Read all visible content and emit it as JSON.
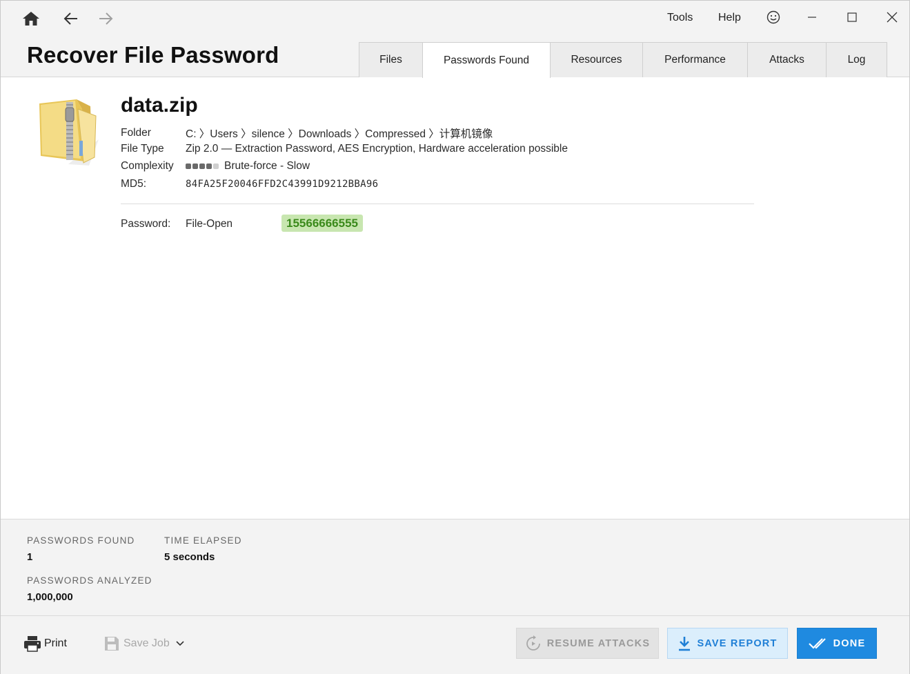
{
  "header": {
    "title": "Recover File Password",
    "menu": {
      "tools": "Tools",
      "help": "Help"
    },
    "tabs": [
      {
        "label": "Files"
      },
      {
        "label": "Passwords Found"
      },
      {
        "label": "Resources"
      },
      {
        "label": "Performance"
      },
      {
        "label": "Attacks"
      },
      {
        "label": "Log"
      }
    ],
    "active_tab": "Passwords Found"
  },
  "file": {
    "name": "data.zip",
    "folder_label": "Folder",
    "folder_value": "C: 〉Users 〉silence 〉Downloads 〉Compressed 〉计算机镜像",
    "type_label": "File Type",
    "type_value": "Zip 2.0 — Extraction Password, AES Encryption, Hardware acceleration possible",
    "complexity_label": "Complexity",
    "complexity_level": 4,
    "complexity_max": 5,
    "complexity_value": "Brute-force - Slow",
    "md5_label": "MD5:",
    "md5_value": "84FA25F20046FFD2C43991D9212BBA96"
  },
  "password": {
    "label": "Password:",
    "kind": "File-Open",
    "value": "15566666555"
  },
  "stats": {
    "found_label": "PASSWORDS FOUND",
    "found_value": "1",
    "elapsed_label": "TIME ELAPSED",
    "elapsed_value": "5 seconds",
    "analyzed_label": "PASSWORDS ANALYZED",
    "analyzed_value": "1,000,000"
  },
  "footer": {
    "print_label": "Print",
    "save_job_label": "Save Job",
    "resume_label": "RESUME ATTACKS",
    "save_report_label": "SAVE REPORT",
    "done_label": "DONE"
  },
  "colors": {
    "accent": "#1f8ae0",
    "password_badge_bg": "#c8e6b0",
    "password_text": "#3a8a1a"
  }
}
